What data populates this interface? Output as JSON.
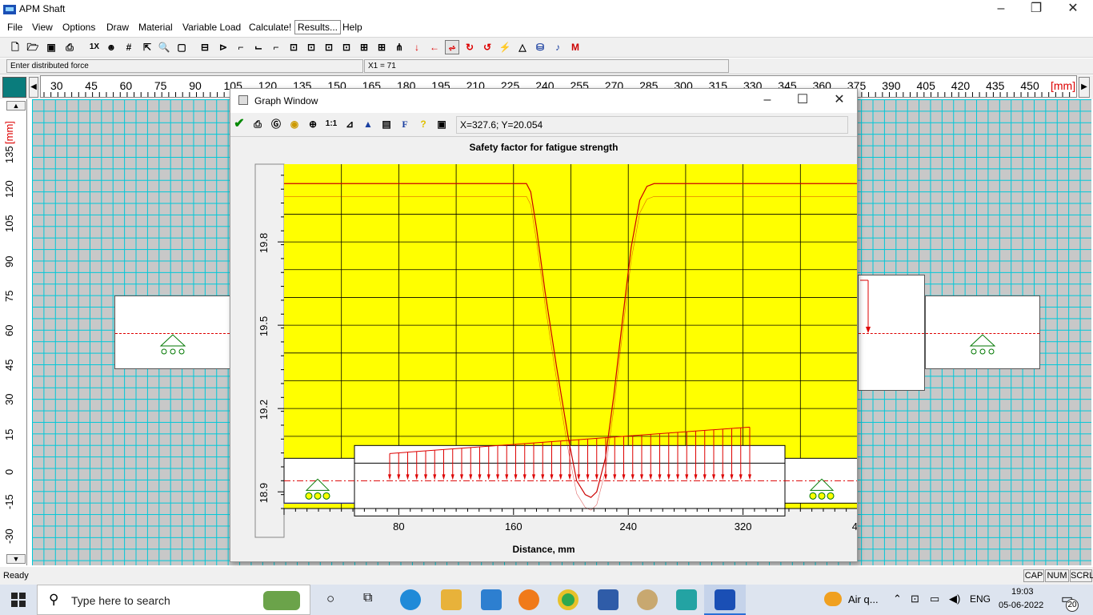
{
  "window": {
    "title": "APM Shaft"
  },
  "menu": [
    "File",
    "View",
    "Options",
    "Draw",
    "Material",
    "Variable Load",
    "Calculate!",
    "Results...",
    "Help"
  ],
  "hint": "Enter distributed force",
  "coord": "X1 = 71",
  "ruler": {
    "units": "[mm]",
    "h_ticks": [
      "30",
      "45",
      "60",
      "75",
      "90",
      "105",
      "120",
      "135",
      "150",
      "165",
      "180",
      "195",
      "210",
      "225",
      "240",
      "255",
      "270",
      "285",
      "300",
      "315",
      "330",
      "345",
      "360",
      "375",
      "390",
      "405",
      "420",
      "435",
      "450"
    ],
    "v_ticks": [
      "135",
      "120",
      "105",
      "90",
      "75",
      "60",
      "45",
      "30",
      "15",
      "0",
      "-15",
      "-30"
    ]
  },
  "graph": {
    "title": "Graph Window",
    "coord_readout": "X=327.6; Y=20.054",
    "chart_title": "Safety factor for fatigue strength",
    "xlabel": "Distance, mm"
  },
  "chart_data": {
    "type": "line",
    "title": "Safety factor for fatigue strength",
    "xlabel": "Distance, mm",
    "ylabel": "",
    "x_ticks": [
      "80",
      "160",
      "240",
      "320",
      "4"
    ],
    "y_ticks": [
      "19.8",
      "19.5",
      "19.2",
      "18.9"
    ],
    "xlim": [
      0,
      400
    ],
    "ylim": [
      18.84,
      20.08
    ],
    "grid": true,
    "background": "#ffff00",
    "series": [
      {
        "color": "#cc0000",
        "x": [
          0,
          169,
          172,
          176,
          182,
          190,
          198,
          204,
          210,
          214,
          218,
          224,
          230,
          236,
          242,
          248,
          253,
          258,
          262,
          400
        ],
        "y": [
          20.01,
          20.01,
          19.98,
          19.85,
          19.62,
          19.35,
          19.1,
          18.94,
          18.89,
          18.88,
          18.9,
          19.02,
          19.25,
          19.52,
          19.78,
          19.95,
          20.0,
          20.01,
          20.01,
          20.01
        ]
      }
    ]
  },
  "status": {
    "text": "Ready",
    "indicators": [
      "CAP",
      "NUM",
      "SCRL"
    ]
  },
  "taskbar": {
    "search_placeholder": "Type here to search",
    "weather": "Air q...",
    "lang": "ENG",
    "time": "19:03",
    "date": "05-06-2022",
    "notifications": "20"
  }
}
